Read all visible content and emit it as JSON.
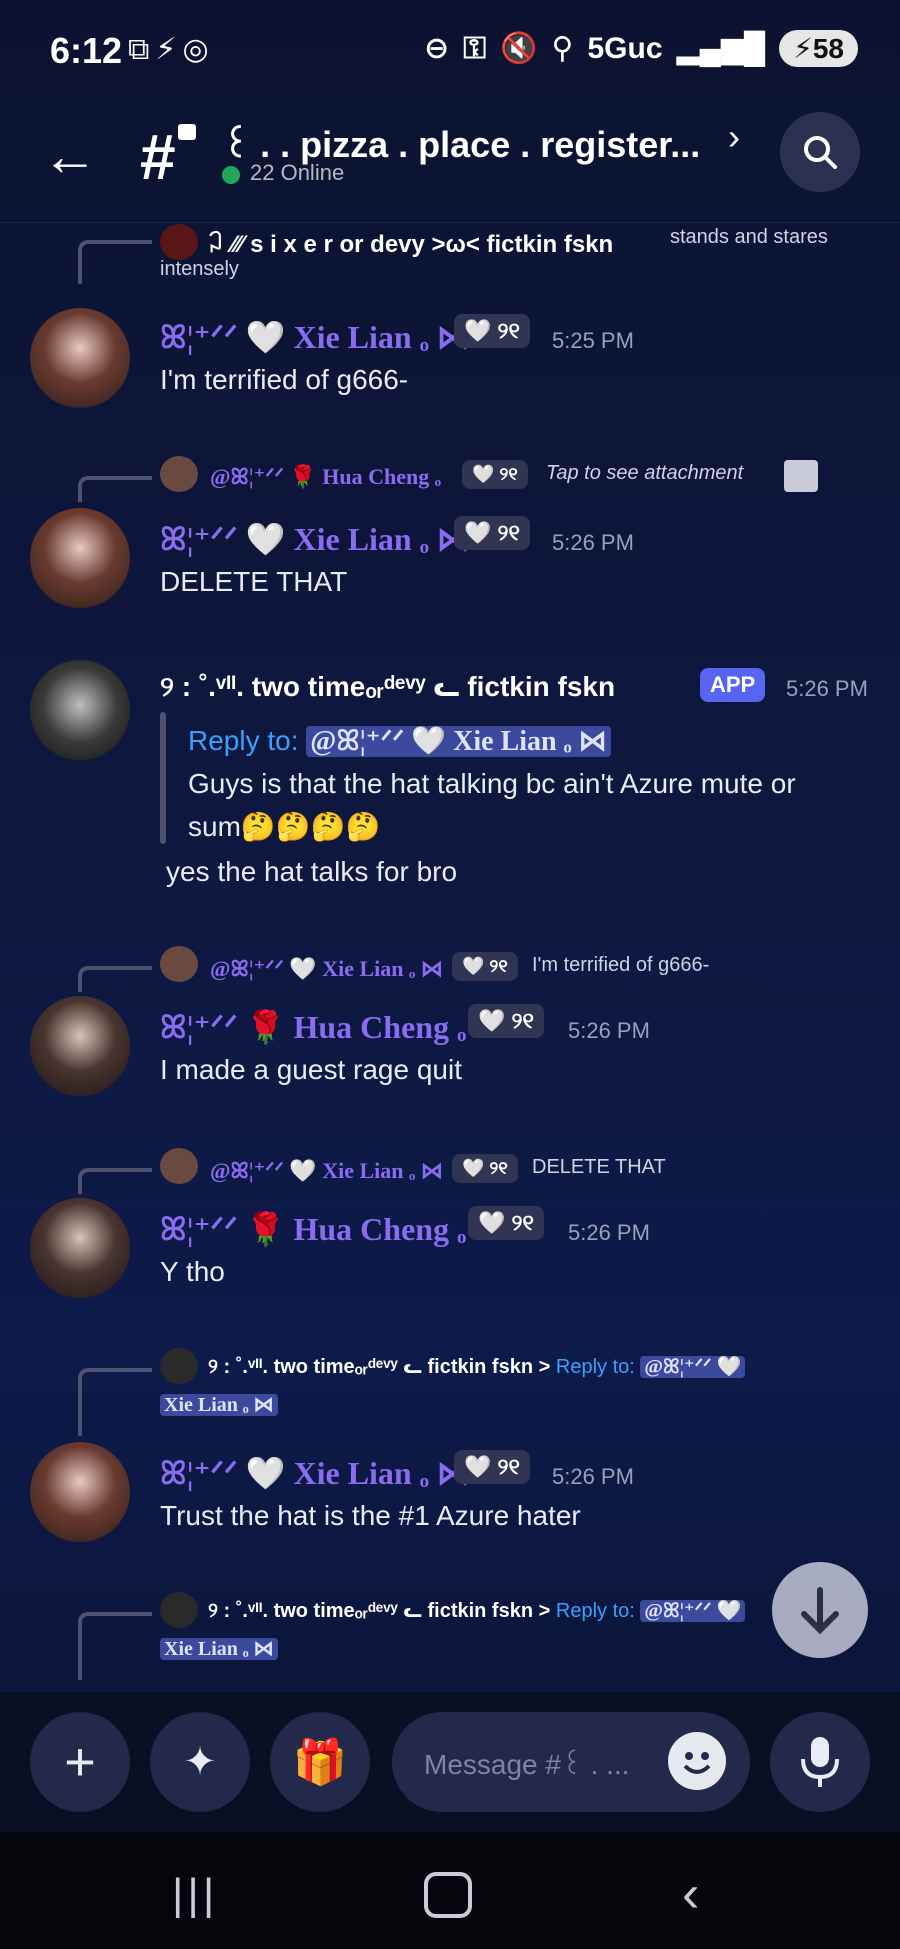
{
  "status_bar": {
    "time": "6:12",
    "left_icons": "⧉⚡◎",
    "network": "5Guc",
    "battery": "58"
  },
  "header": {
    "channel_name": "꒰ . . pizza . place . register...",
    "online": "22 Online"
  },
  "messages": [
    {
      "reply_author": "꒜ ⁄⁄⁄ s i x e r or devy >ω< fictkin fskn",
      "reply_text": "stands and stares",
      "reply_text2": "intensely",
      "author": "ꕤ¦⁺ᐟᐟ 🤍 Xie Lian ₒ ⋈",
      "badge": "🤍 ୨୧",
      "time": "5:25 PM",
      "text": "I'm terrified of g666-"
    },
    {
      "reply_author": "@ꕤ¦⁺ᐟᐟ 🌹 Hua Cheng ₒ",
      "reply_badge": "🤍 ୨୧",
      "reply_text": "Tap to see attachment",
      "author": "ꕤ¦⁺ᐟᐟ 🤍 Xie Lian ₒ ⋈",
      "badge": "🤍 ୨୧",
      "time": "5:26 PM",
      "text": "DELETE THAT"
    },
    {
      "author": "୨ : ˚.ᵛᴵᴵ. two timeₒᵣᵈᵉᵛʸ ᓚ fictkin fskn",
      "app_badge": "APP",
      "time": "5:26 PM",
      "embed_reply_label": "Reply to:",
      "embed_reply_mention": "@ꕤ¦⁺ᐟᐟ 🤍 Xie Lian ₒ ⋈",
      "embed_line1": "Guys is that the hat talking bc ain't Azure mute or",
      "embed_line2": "sum🤔🤔🤔🤔",
      "text": "yes the hat talks for bro"
    },
    {
      "reply_author": "@ꕤ¦⁺ᐟᐟ 🤍 Xie Lian ₒ ⋈",
      "reply_badge": "🤍 ୨୧",
      "reply_text": "I'm terrified of g666-",
      "author": "ꕤ¦⁺ᐟᐟ 🌹 Hua Cheng ₒ",
      "badge": "🤍 ୨୧",
      "time": "5:26 PM",
      "text": "I made a guest rage quit"
    },
    {
      "reply_author": "@ꕤ¦⁺ᐟᐟ 🤍 Xie Lian ₒ ⋈",
      "reply_badge": "🤍 ୨୧",
      "reply_text": "DELETE THAT",
      "author": "ꕤ¦⁺ᐟᐟ 🌹 Hua Cheng ₒ",
      "badge": "🤍 ୨୧",
      "time": "5:26 PM",
      "text": "Y tho"
    },
    {
      "reply_author": "୨ : ˚.ᵛᴵᴵ. two timeₒᵣᵈᵉᵛʸ ᓚ fictkin fskn",
      "reply_arrow": ">",
      "reply_label": "Reply to:",
      "reply_mention": "@ꕤ¦⁺ᐟᐟ 🤍",
      "reply_mention2": "Xie Lian ₒ ⋈",
      "author": "ꕤ¦⁺ᐟᐟ 🤍 Xie Lian ₒ ⋈",
      "badge": "🤍 ୨୧",
      "time": "5:26 PM",
      "text": "Trust the hat is the #1 Azure hater"
    },
    {
      "reply_author": "୨ : ˚.ᵛᴵᴵ. two timeₒᵣᵈᵉᵛʸ ᓚ fictkin fskn",
      "reply_arrow": ">",
      "reply_label": "Reply to:",
      "reply_mention": "@ꕤ¦⁺ᐟᐟ 🤍",
      "reply_mention2": "Xie Lian ₒ ⋈"
    }
  ],
  "composer": {
    "placeholder": "Message #꒰ . ..."
  }
}
